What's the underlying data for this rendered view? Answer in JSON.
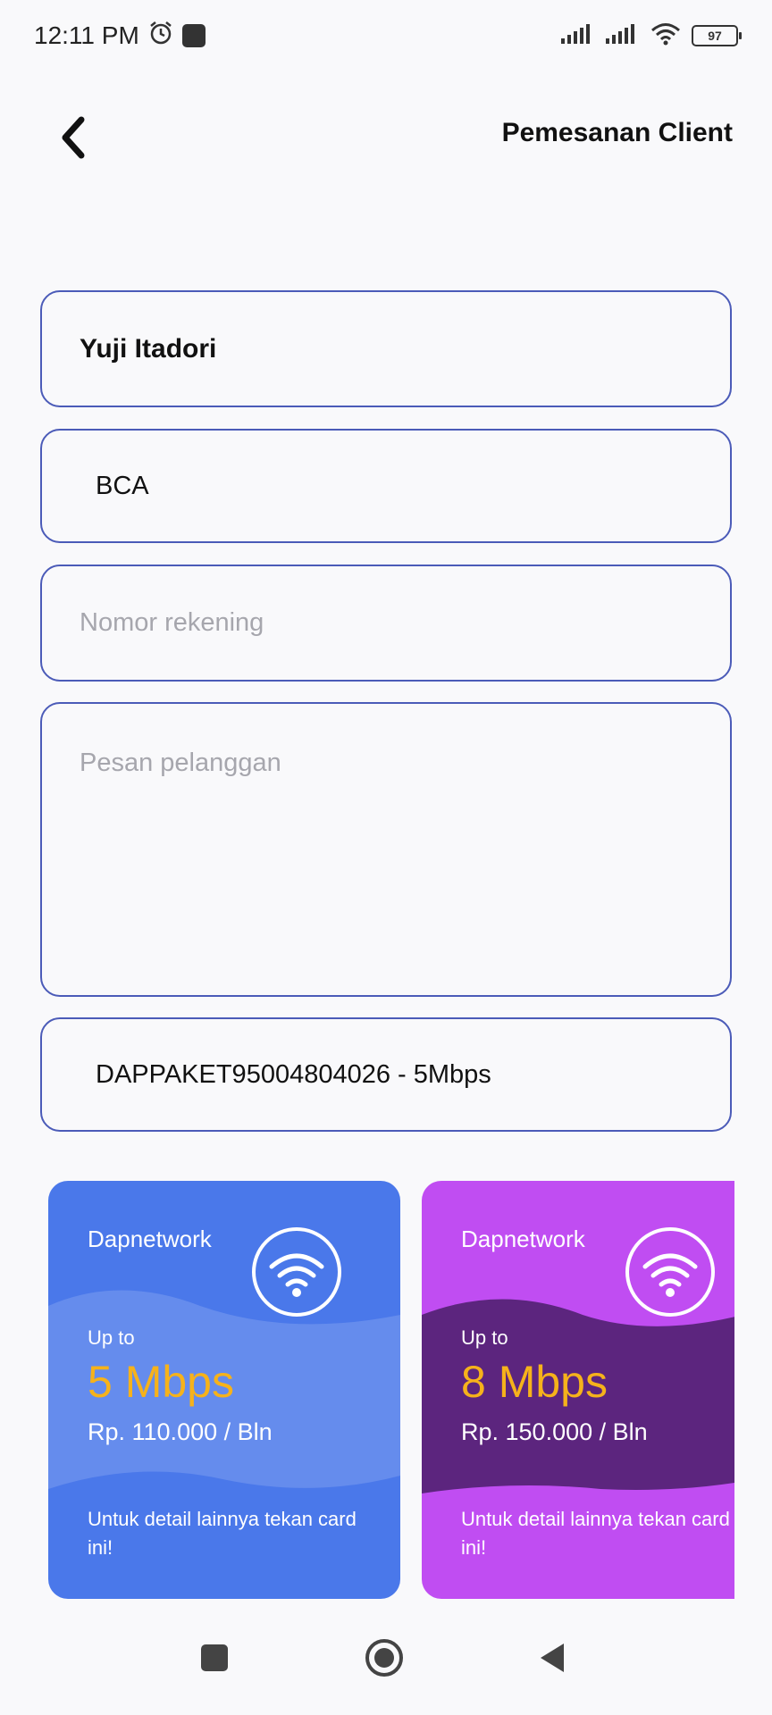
{
  "status_bar": {
    "time": "12:11 PM",
    "icons": [
      "alarm-icon",
      "app-notification-icon",
      "signal-icon",
      "signal-icon",
      "wifi-icon"
    ],
    "battery": "97"
  },
  "header": {
    "title": "Pemesanan Client",
    "back_icon": "chevron-left-icon"
  },
  "form": {
    "name_value": "Yuji Itadori",
    "bank_value": "BCA",
    "rekening_placeholder": "Nomor rekening",
    "pesan_placeholder": "Pesan pelanggan",
    "paket_value": "DAPPAKET95004804026 - 5Mbps"
  },
  "cards": [
    {
      "brand": "Dapnetwork",
      "up_to": "Up to",
      "speed": "5 Mbps",
      "price": "Rp. 110.000 / Bln",
      "note": "Untuk detail lainnya tekan card ini!",
      "color": "#4a78ea"
    },
    {
      "brand": "Dapnetwork",
      "up_to": "Up to",
      "speed": "8 Mbps",
      "price": "Rp. 150.000 / Bln",
      "note": "Untuk detail lainnya tekan card ini!",
      "color": "#c04df2"
    }
  ],
  "nav_bar": {
    "icons": [
      "recents-square-icon",
      "home-circle-icon",
      "back-triangle-icon"
    ]
  }
}
